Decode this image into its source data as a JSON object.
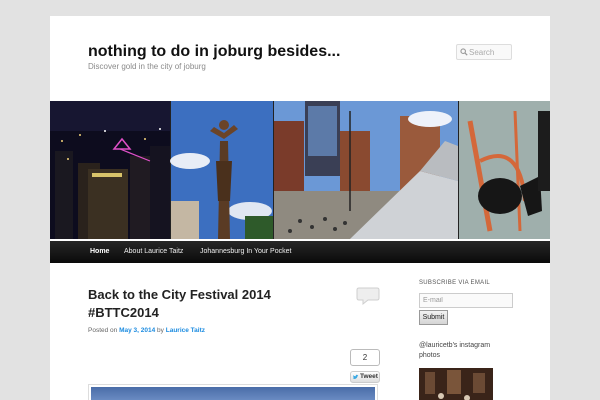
{
  "site": {
    "title": "nothing to do in joburg besides...",
    "description": "Discover gold in the city of joburg"
  },
  "search": {
    "placeholder": "Search"
  },
  "nav": {
    "items": [
      {
        "label": "Home",
        "active": true
      },
      {
        "label": "About Laurice Taitz",
        "active": false
      },
      {
        "label": "Johannesburg In Your Pocket",
        "active": false
      }
    ]
  },
  "post": {
    "title": "Back to the City Festival 2014 #BTTC2014",
    "meta_prefix": "Posted on",
    "date": "May 3, 2014",
    "meta_by": "by",
    "author": "Laurice Taitz"
  },
  "tweet": {
    "count": "2",
    "label": "Tweet"
  },
  "sidebar": {
    "subscribe_title": "SUBSCRIBE VIA EMAIL",
    "email_placeholder": "E-mail",
    "submit_label": "Submit",
    "instagram_title": "@lauricetb's instagram photos"
  },
  "colors": {
    "link": "#1b8be0",
    "nav_bg": "#111111",
    "page_bg": "#e2e2e2"
  }
}
